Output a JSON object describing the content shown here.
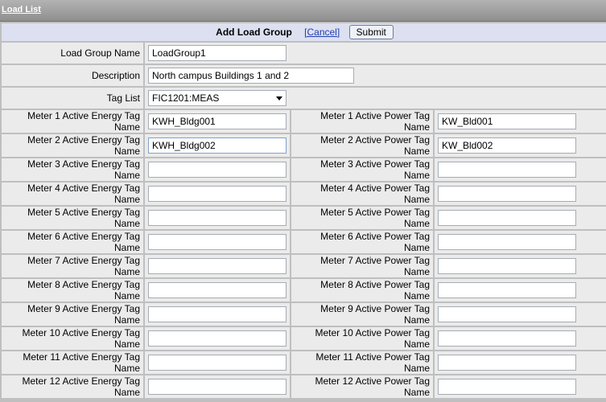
{
  "topbar": {
    "load_list_link": "Load List"
  },
  "header": {
    "title": "Add Load Group",
    "cancel_label": "[Cancel]",
    "submit_label": "Submit"
  },
  "fields": {
    "load_group_name": {
      "label": "Load Group Name",
      "value": "LoadGroup1"
    },
    "description": {
      "label": "Description",
      "value": "North campus Buildings 1 and 2"
    },
    "tag_list": {
      "label": "Tag List",
      "selected": "FIC1201:MEAS"
    }
  },
  "meters": [
    {
      "energy_label": "Meter 1 Active Energy Tag Name",
      "energy_value": "KWH_Bldg001",
      "power_label": "Meter 1 Active Power Tag Name",
      "power_value": "KW_Bld001"
    },
    {
      "energy_label": "Meter 2 Active Energy Tag Name",
      "energy_value": "KWH_Bldg002",
      "power_label": "Meter 2 Active Power Tag Name",
      "power_value": "KW_Bld002"
    },
    {
      "energy_label": "Meter 3 Active Energy Tag Name",
      "energy_value": "",
      "power_label": "Meter 3 Active Power Tag Name",
      "power_value": ""
    },
    {
      "energy_label": "Meter 4 Active Energy Tag Name",
      "energy_value": "",
      "power_label": "Meter 4 Active Power Tag Name",
      "power_value": ""
    },
    {
      "energy_label": "Meter 5 Active Energy Tag Name",
      "energy_value": "",
      "power_label": "Meter 5 Active Power Tag Name",
      "power_value": ""
    },
    {
      "energy_label": "Meter 6 Active Energy Tag Name",
      "energy_value": "",
      "power_label": "Meter 6 Active Power Tag Name",
      "power_value": ""
    },
    {
      "energy_label": "Meter 7 Active Energy Tag Name",
      "energy_value": "",
      "power_label": "Meter 7 Active Power Tag Name",
      "power_value": ""
    },
    {
      "energy_label": "Meter 8 Active Energy Tag Name",
      "energy_value": "",
      "power_label": "Meter 8 Active Power Tag Name",
      "power_value": ""
    },
    {
      "energy_label": "Meter 9 Active Energy Tag Name",
      "energy_value": "",
      "power_label": "Meter 9 Active Power Tag Name",
      "power_value": ""
    },
    {
      "energy_label": "Meter 10 Active Energy Tag Name",
      "energy_value": "",
      "power_label": "Meter 10 Active Power Tag Name",
      "power_value": ""
    },
    {
      "energy_label": "Meter 11 Active Energy Tag Name",
      "energy_value": "",
      "power_label": "Meter 11 Active Power Tag Name",
      "power_value": ""
    },
    {
      "energy_label": "Meter 12 Active Energy Tag Name",
      "energy_value": "",
      "power_label": "Meter 12 Active Power Tag Name",
      "power_value": ""
    }
  ]
}
